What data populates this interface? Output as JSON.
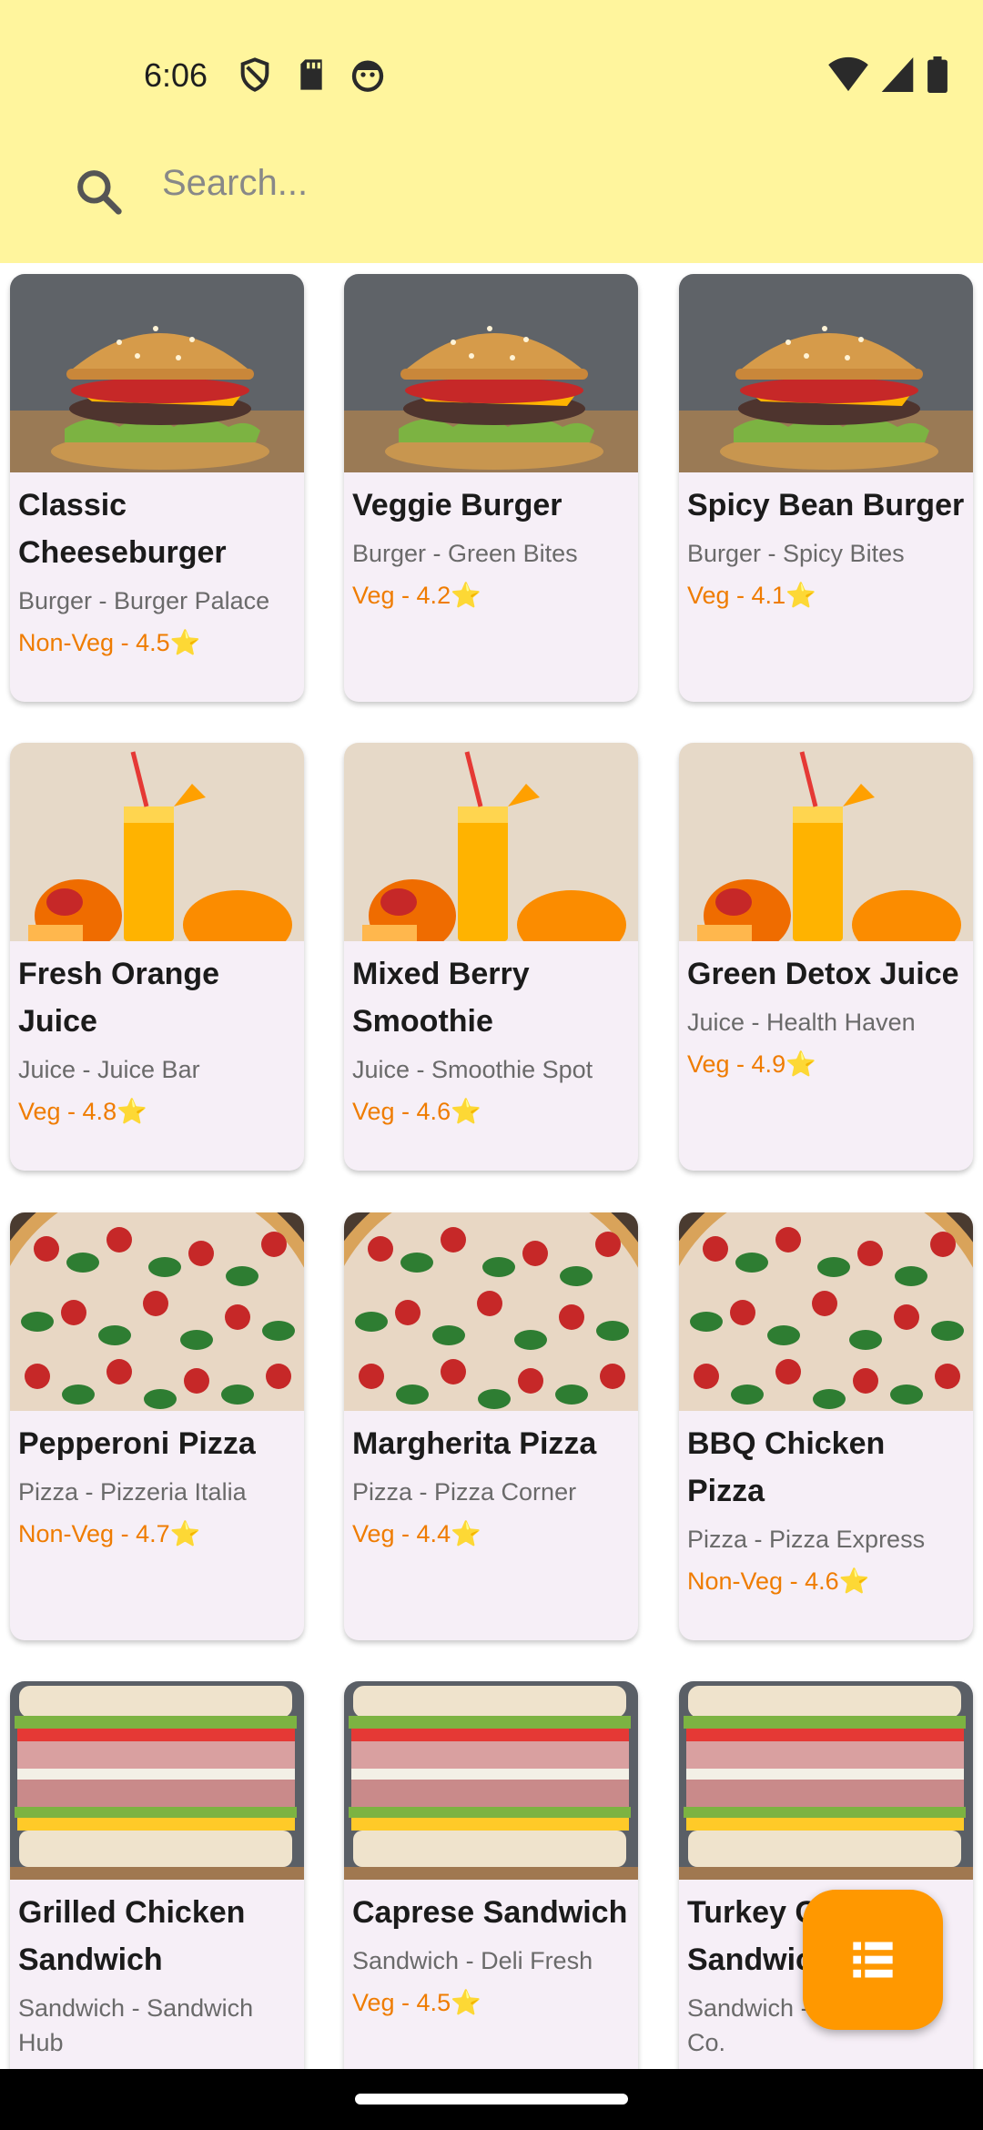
{
  "status_bar": {
    "time": "6:06"
  },
  "search": {
    "placeholder": "Search..."
  },
  "items": [
    {
      "title": "Classic Cheeseburger",
      "subtitle": "Burger - Burger Palace",
      "rating": "Non-Veg - 4.5⭐",
      "image": "burger"
    },
    {
      "title": "Veggie Burger",
      "subtitle": "Burger - Green Bites",
      "rating": "Veg - 4.2⭐",
      "image": "burger"
    },
    {
      "title": "Spicy Bean Burger",
      "subtitle": "Burger - Spicy Bites",
      "rating": "Veg - 4.1⭐",
      "image": "burger"
    },
    {
      "title": "Fresh Orange Juice",
      "subtitle": "Juice - Juice Bar",
      "rating": "Veg - 4.8⭐",
      "image": "juice"
    },
    {
      "title": "Mixed Berry Smoothie",
      "subtitle": "Juice - Smoothie Spot",
      "rating": "Veg - 4.6⭐",
      "image": "juice"
    },
    {
      "title": "Green Detox Juice",
      "subtitle": "Juice - Health Haven",
      "rating": "Veg - 4.9⭐",
      "image": "juice"
    },
    {
      "title": "Pepperoni Pizza",
      "subtitle": "Pizza - Pizzeria Italia",
      "rating": "Non-Veg - 4.7⭐",
      "image": "pizza"
    },
    {
      "title": "Margherita Pizza",
      "subtitle": "Pizza - Pizza Corner",
      "rating": "Veg - 4.4⭐",
      "image": "pizza"
    },
    {
      "title": "BBQ Chicken Pizza",
      "subtitle": "Pizza - Pizza Express",
      "rating": "Non-Veg - 4.6⭐",
      "image": "pizza"
    },
    {
      "title": "Grilled Chicken Sandwich",
      "subtitle": "Sandwich - Sandwich Hub",
      "rating": "",
      "image": "sandwich"
    },
    {
      "title": "Caprese Sandwich",
      "subtitle": "Sandwich - Deli Fresh",
      "rating": "Veg - 4.5⭐",
      "image": "sandwich"
    },
    {
      "title": "Turkey Club Sandwich",
      "subtitle": "Sandwich - Sandwich Co.",
      "rating": "",
      "image": "sandwich"
    }
  ],
  "fab": {
    "icon": "list-icon"
  },
  "colors": {
    "header": "#fff59d",
    "card": "#f6eff7",
    "accent": "#ff9800",
    "rating": "#ef7c00"
  }
}
